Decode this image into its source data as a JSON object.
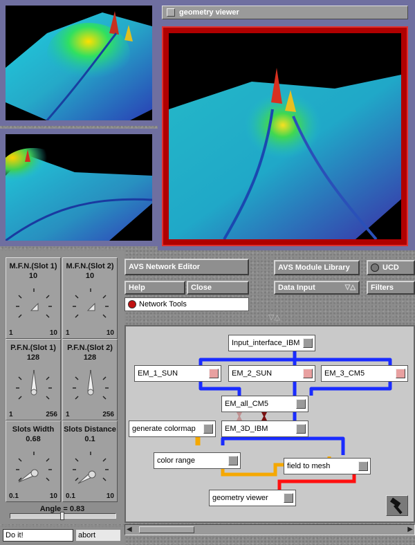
{
  "viewer": {
    "title": "geometry viewer"
  },
  "dials": [
    {
      "title": "M.F.N.(Slot 1)",
      "value": "10",
      "min": "1",
      "max": "10"
    },
    {
      "title": "M.F.N.(Slot 2)",
      "value": "10",
      "min": "1",
      "max": "10"
    },
    {
      "title": "P.F.N.(Slot 1)",
      "value": "128",
      "min": "1",
      "max": "256"
    },
    {
      "title": "P.F.N.(Slot 2)",
      "value": "128",
      "min": "1",
      "max": "256"
    },
    {
      "title": "Slots Width",
      "value": "0.68",
      "min": "0.1",
      "max": "10"
    },
    {
      "title": "Slots Distance",
      "value": "0.1",
      "min": "0.1",
      "max": "10"
    }
  ],
  "angle": {
    "label": "Angle = 0.83",
    "fraction": 0.5
  },
  "command": {
    "input_value": "Do it!",
    "abort_label": "abort"
  },
  "network_editor": {
    "title": "AVS Network Editor",
    "help_label": "Help",
    "close_label": "Close",
    "tools_label": "Network Tools"
  },
  "module_library": {
    "title": "AVS Module Library",
    "ucd_label": "UCD",
    "category": "Data Input",
    "filters_label": "Filters"
  },
  "modules": {
    "input_interface": "Input_interface_IBM",
    "em1": "EM_1_SUN",
    "em2": "EM_2_SUN",
    "em3": "EM_3_CM5",
    "em_all": "EM_all_CM5",
    "gen_cmap": "generate colormap",
    "em3d": "EM_3D_IBM",
    "color_range": "color range",
    "field_to_mesh": "field to mesh",
    "geometry_viewer": "geometry viewer"
  },
  "colors": {
    "conn_blue": "#1a2cff",
    "conn_orange": "#f5a800",
    "conn_red": "#ff1010",
    "viewer_border": "#b00000"
  }
}
